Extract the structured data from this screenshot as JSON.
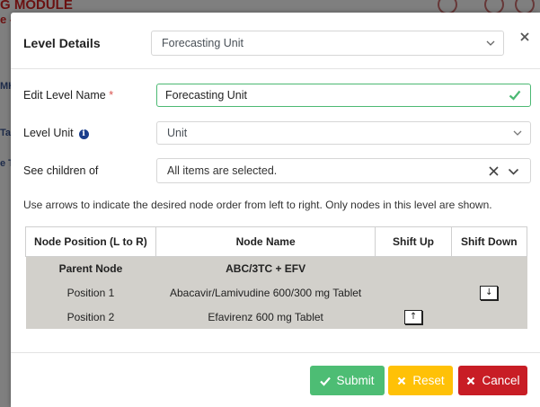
{
  "background": {
    "title_fragment": "G MODULE",
    "subtitle_fragment": "e -",
    "side_fragments": [
      "MH",
      "Ta",
      "e T"
    ]
  },
  "modal": {
    "title": "Level Details",
    "level_select": {
      "value": "Forecasting Unit"
    },
    "fields": {
      "edit_level_name": {
        "label": "Edit Level Name",
        "required_mark": "*",
        "value": "Forecasting Unit"
      },
      "level_unit": {
        "label": "Level Unit",
        "info_glyph": "i",
        "value": "Unit"
      },
      "see_children_of": {
        "label": "See children of",
        "value": "All items are selected."
      }
    },
    "hint": "Use arrows to indicate the desired node order from left to right. Only nodes in this level are shown.",
    "table": {
      "headers": [
        "Node Position (L to R)",
        "Node Name",
        "Shift Up",
        "Shift Down"
      ],
      "parent": {
        "position": "Parent Node",
        "name": "ABC/3TC + EFV"
      },
      "rows": [
        {
          "position": "Position 1",
          "name": "Abacavir/Lamivudine 600/300 mg Tablet",
          "shift_up": "",
          "shift_down": "↓"
        },
        {
          "position": "Position 2",
          "name": "Efavirenz 600 mg Tablet",
          "shift_up": "↑",
          "shift_down": ""
        }
      ]
    },
    "buttons": {
      "submit": "Submit",
      "reset": "Reset",
      "cancel": "Cancel"
    }
  },
  "colors": {
    "submit": "#4dbd74",
    "reset": "#ffc107",
    "cancel": "#c81d25",
    "valid": "#4cb973"
  }
}
